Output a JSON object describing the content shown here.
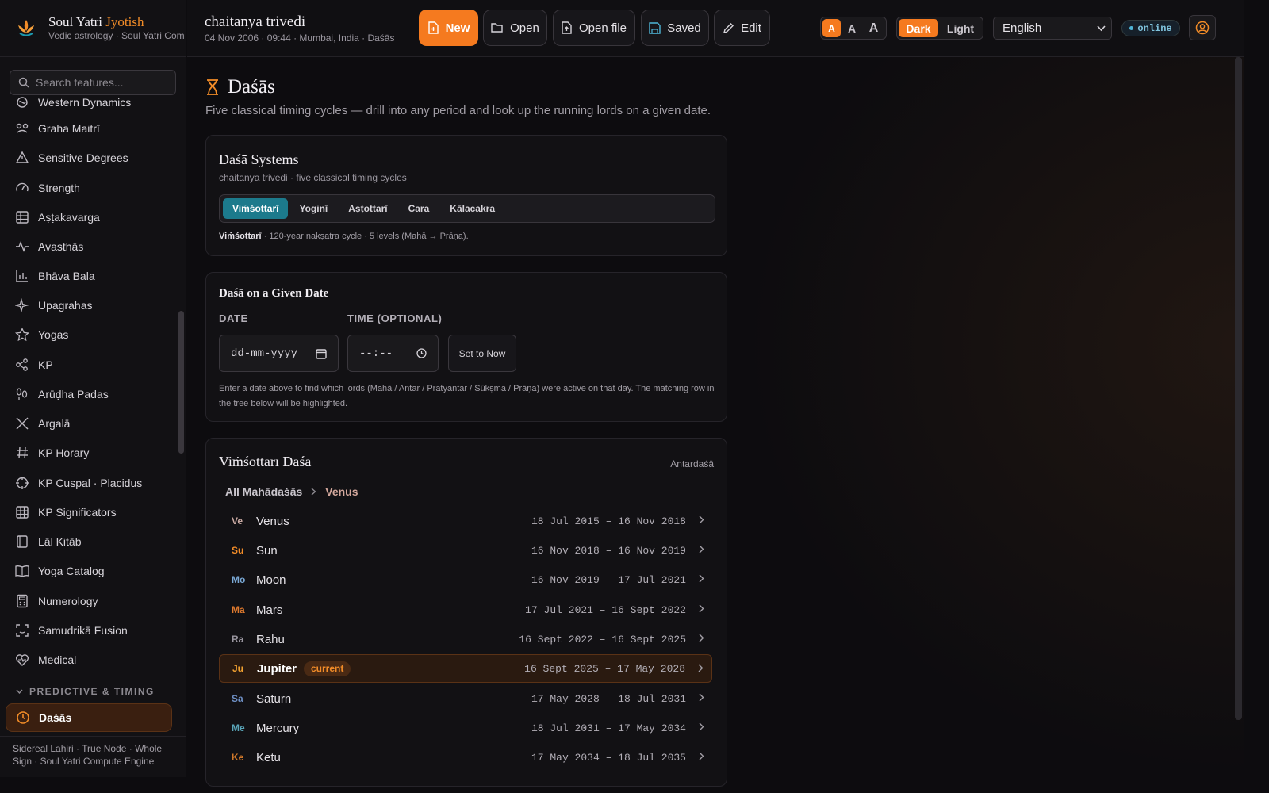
{
  "brand": {
    "name": "Soul Yatri",
    "name_accent": "Jyotish",
    "subtitle": "Vedic astrology · Soul Yatri Com"
  },
  "search": {
    "placeholder": "Search features..."
  },
  "sidebar": {
    "items": [
      {
        "label": "Western Dynamics",
        "icon": "dynamics-icon"
      },
      {
        "label": "Graha Maitrī",
        "icon": "friendship-icon"
      },
      {
        "label": "Sensitive Degrees",
        "icon": "warning-icon"
      },
      {
        "label": "Strength",
        "icon": "gauge-icon"
      },
      {
        "label": "Aṣṭakavarga",
        "icon": "grid-icon"
      },
      {
        "label": "Avasthās",
        "icon": "pulse-icon"
      },
      {
        "label": "Bhāva Bala",
        "icon": "bar-chart-icon"
      },
      {
        "label": "Upagrahas",
        "icon": "sparkle-icon"
      },
      {
        "label": "Yogas",
        "icon": "star-icon"
      },
      {
        "label": "KP",
        "icon": "share-icon"
      },
      {
        "label": "Arūḍha Padas",
        "icon": "footprints-icon"
      },
      {
        "label": "Argalā",
        "icon": "swords-icon"
      },
      {
        "label": "KP Horary",
        "icon": "hash-icon"
      },
      {
        "label": "KP Cuspal · Placidus",
        "icon": "crosshair-icon"
      },
      {
        "label": "KP Significators",
        "icon": "table-icon"
      },
      {
        "label": "Lāl Kitāb",
        "icon": "book-icon"
      },
      {
        "label": "Yoga Catalog",
        "icon": "open-book-icon"
      },
      {
        "label": "Numerology",
        "icon": "calculator-icon"
      },
      {
        "label": "Samudrikā Fusion",
        "icon": "scan-face-icon"
      },
      {
        "label": "Medical",
        "icon": "heart-pulse-icon"
      }
    ],
    "section_label": "PREDICTIVE & TIMING",
    "active_item": "Daśās",
    "footer": "Sidereal Lahiri · True Node · Whole Sign · Soul Yatri Compute Engine"
  },
  "header": {
    "title": "chaitanya trivedi",
    "subtitle": "04 Nov 2006 · 09:44 · Mumbai, India  ·  Daśās",
    "buttons": {
      "new": "New",
      "open": "Open",
      "open_file": "Open file",
      "saved": "Saved",
      "edit": "Edit"
    },
    "font_sizes": [
      "A",
      "A",
      "A"
    ],
    "theme": {
      "dark": "Dark",
      "light": "Light",
      "active": "Dark"
    },
    "language": "English",
    "status": "online"
  },
  "page": {
    "title": "Daśās",
    "subtitle": "Five classical timing cycles — drill into any period and look up the running lords on a given date."
  },
  "systems_card": {
    "title": "Daśā Systems",
    "subtitle": "chaitanya trivedi · five classical timing cycles",
    "tabs": [
      "Viṁśottarī",
      "Yoginī",
      "Aṣṭottarī",
      "Cara",
      "Kālacakra"
    ],
    "active_tab": "Viṁśottarī",
    "desc_bold": "Viṁśottarī",
    "desc": " · 120-year nakṣatra cycle · 5 levels (Mahā → Prāṇa)."
  },
  "date_card": {
    "title": "Daśā on a Given Date",
    "date_label": "DATE",
    "date_placeholder": "dd-mm-yyyy",
    "time_label": "TIME (OPTIONAL)",
    "time_placeholder": "--:--",
    "set_now": "Set to Now",
    "help": "Enter a date above to find which lords (Mahā / Antar / Pratyantar / Sūkṣma / Prāṇa) were active on that day. The matching row in the tree below will be highlighted."
  },
  "tree_card": {
    "title": "Viṁśottarī Daśā",
    "level": "Antardaśā",
    "breadcrumb": [
      "All Mahādaśās",
      "Venus"
    ],
    "current_badge": "current",
    "rows": [
      {
        "abbr": "Ve",
        "name": "Venus",
        "range": "18 Jul 2015 – 16 Nov 2018",
        "color": "#c8a9a2",
        "current": false
      },
      {
        "abbr": "Su",
        "name": "Sun",
        "range": "16 Nov 2018 – 16 Nov 2019",
        "color": "#f28c28",
        "current": false
      },
      {
        "abbr": "Mo",
        "name": "Moon",
        "range": "16 Nov 2019 – 17 Jul 2021",
        "color": "#7aa9d6",
        "current": false
      },
      {
        "abbr": "Ma",
        "name": "Mars",
        "range": "17 Jul 2021 – 16 Sept 2022",
        "color": "#e07a2e",
        "current": false
      },
      {
        "abbr": "Ra",
        "name": "Rahu",
        "range": "16 Sept 2022 – 16 Sept 2025",
        "color": "#9a96a0",
        "current": false
      },
      {
        "abbr": "Ju",
        "name": "Jupiter",
        "range": "16 Sept 2025 – 17 May 2028",
        "color": "#f0a030",
        "current": true
      },
      {
        "abbr": "Sa",
        "name": "Saturn",
        "range": "17 May 2028 – 18 Jul 2031",
        "color": "#6e8fc4",
        "current": false
      },
      {
        "abbr": "Me",
        "name": "Mercury",
        "range": "18 Jul 2031 – 17 May 2034",
        "color": "#5aa5b8",
        "current": false
      },
      {
        "abbr": "Ke",
        "name": "Ketu",
        "range": "17 May 2034 – 18 Jul 2035",
        "color": "#d0782a",
        "current": false
      }
    ]
  },
  "colors": {
    "accent": "#f57a1f",
    "teal": "#1c7a8c",
    "bg": "#0d0c0f"
  }
}
